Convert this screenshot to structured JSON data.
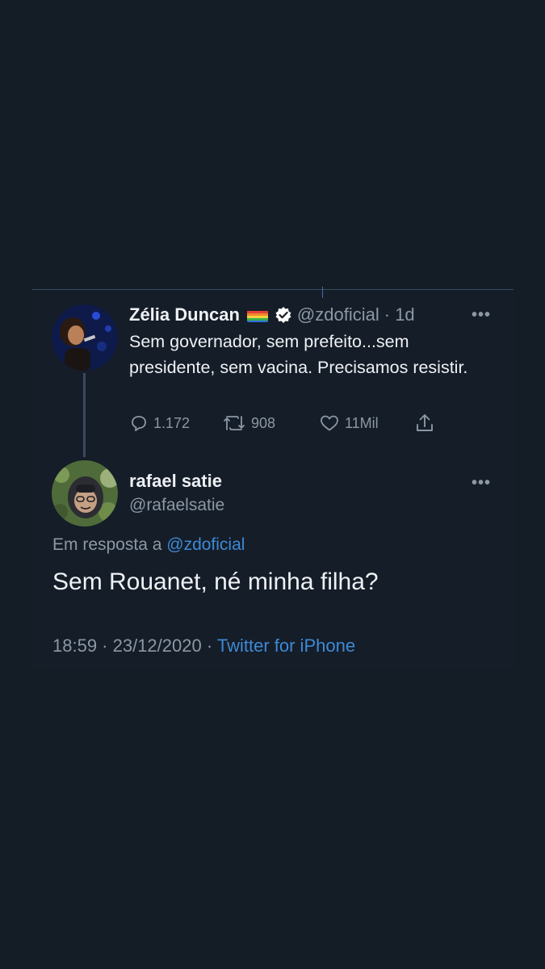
{
  "tweet": {
    "author_name": "Zélia Duncan",
    "author_handle": "@zdoficial",
    "time_ago": "· 1d",
    "text": "Sem governador, sem prefeito...sem presidente, sem vacina. Precisamos resistir.",
    "replies": "1.172",
    "retweets": "908",
    "likes": "11Mil",
    "more_label": "•••",
    "icons": [
      "flag-icon",
      "verified-badge-icon",
      "reply-icon",
      "retweet-icon",
      "like-icon",
      "share-icon",
      "more-icon"
    ]
  },
  "reply": {
    "author_name": "rafael satie",
    "author_handle": "@rafaelsatie",
    "reply_prefix": "Em resposta a",
    "reply_mention": "@zdoficial",
    "text": "Sem Rouanet, né minha filha?",
    "timestamp": "18:59 · 23/12/2020 ·",
    "source": "Twitter for iPhone",
    "more_label": "•••"
  },
  "colors": {
    "background": "#141c25",
    "text": "#eef1f4",
    "muted": "#8b98a5",
    "accent": "#3d8ad6"
  }
}
